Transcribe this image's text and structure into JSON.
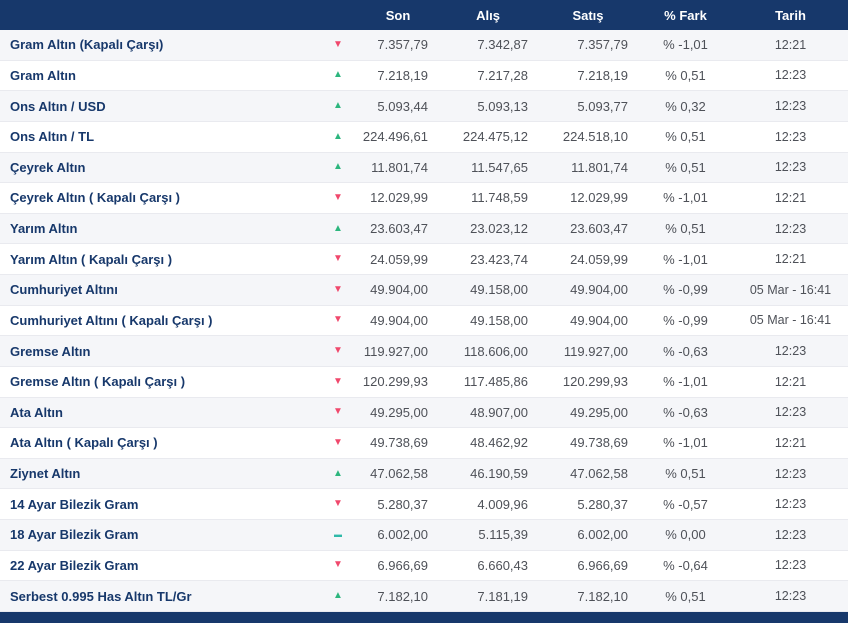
{
  "colors": {
    "header_bg": "#17386b",
    "footer_bg": "#17386b",
    "name_text": "#17386b",
    "value_text": "#4e5158",
    "row_alt_bg": "#f5f6f9",
    "row_border": "#e9eaef",
    "up": "#2db67e",
    "down": "#f0486c",
    "flat": "#2fb9a9"
  },
  "icons": {
    "up": "▲",
    "down": "▼",
    "flat": "▬"
  },
  "header": {
    "name": "",
    "trend": "",
    "son": "Son",
    "alis": "Alış",
    "satis": "Satış",
    "fark": "% Fark",
    "tarih": "Tarih"
  },
  "rows": [
    {
      "name": "Gram Altın (Kapalı Çarşı)",
      "trend": "down",
      "son": "7.357,79",
      "alis": "7.342,87",
      "satis": "7.357,79",
      "fark": "% -1,01",
      "tarih": "12:21"
    },
    {
      "name": "Gram Altın",
      "trend": "up",
      "son": "7.218,19",
      "alis": "7.217,28",
      "satis": "7.218,19",
      "fark": "% 0,51",
      "tarih": "12:23"
    },
    {
      "name": "Ons Altın / USD",
      "trend": "up",
      "son": "5.093,44",
      "alis": "5.093,13",
      "satis": "5.093,77",
      "fark": "% 0,32",
      "tarih": "12:23"
    },
    {
      "name": "Ons Altın / TL",
      "trend": "up",
      "son": "224.496,61",
      "alis": "224.475,12",
      "satis": "224.518,10",
      "fark": "% 0,51",
      "tarih": "12:23"
    },
    {
      "name": "Çeyrek Altın",
      "trend": "up",
      "son": "11.801,74",
      "alis": "11.547,65",
      "satis": "11.801,74",
      "fark": "% 0,51",
      "tarih": "12:23"
    },
    {
      "name": "Çeyrek Altın ( Kapalı Çarşı )",
      "trend": "down",
      "son": "12.029,99",
      "alis": "11.748,59",
      "satis": "12.029,99",
      "fark": "% -1,01",
      "tarih": "12:21"
    },
    {
      "name": "Yarım Altın",
      "trend": "up",
      "son": "23.603,47",
      "alis": "23.023,12",
      "satis": "23.603,47",
      "fark": "% 0,51",
      "tarih": "12:23"
    },
    {
      "name": "Yarım Altın ( Kapalı Çarşı )",
      "trend": "down",
      "son": "24.059,99",
      "alis": "23.423,74",
      "satis": "24.059,99",
      "fark": "% -1,01",
      "tarih": "12:21"
    },
    {
      "name": "Cumhuriyet Altını",
      "trend": "down",
      "son": "49.904,00",
      "alis": "49.158,00",
      "satis": "49.904,00",
      "fark": "% -0,99",
      "tarih": "05 Mar - 16:41"
    },
    {
      "name": "Cumhuriyet Altını ( Kapalı Çarşı )",
      "trend": "down",
      "son": "49.904,00",
      "alis": "49.158,00",
      "satis": "49.904,00",
      "fark": "% -0,99",
      "tarih": "05 Mar - 16:41"
    },
    {
      "name": "Gremse Altın",
      "trend": "down",
      "son": "119.927,00",
      "alis": "118.606,00",
      "satis": "119.927,00",
      "fark": "% -0,63",
      "tarih": "12:23"
    },
    {
      "name": "Gremse Altın ( Kapalı Çarşı )",
      "trend": "down",
      "son": "120.299,93",
      "alis": "117.485,86",
      "satis": "120.299,93",
      "fark": "% -1,01",
      "tarih": "12:21"
    },
    {
      "name": "Ata Altın",
      "trend": "down",
      "son": "49.295,00",
      "alis": "48.907,00",
      "satis": "49.295,00",
      "fark": "% -0,63",
      "tarih": "12:23"
    },
    {
      "name": "Ata Altın ( Kapalı Çarşı )",
      "trend": "down",
      "son": "49.738,69",
      "alis": "48.462,92",
      "satis": "49.738,69",
      "fark": "% -1,01",
      "tarih": "12:21"
    },
    {
      "name": "Ziynet Altın",
      "trend": "up",
      "son": "47.062,58",
      "alis": "46.190,59",
      "satis": "47.062,58",
      "fark": "% 0,51",
      "tarih": "12:23"
    },
    {
      "name": "14 Ayar Bilezik Gram",
      "trend": "down",
      "son": "5.280,37",
      "alis": "4.009,96",
      "satis": "5.280,37",
      "fark": "% -0,57",
      "tarih": "12:23"
    },
    {
      "name": "18 Ayar Bilezik Gram",
      "trend": "flat",
      "son": "6.002,00",
      "alis": "5.115,39",
      "satis": "6.002,00",
      "fark": "% 0,00",
      "tarih": "12:23"
    },
    {
      "name": "22 Ayar Bilezik Gram",
      "trend": "down",
      "son": "6.966,69",
      "alis": "6.660,43",
      "satis": "6.966,69",
      "fark": "% -0,64",
      "tarih": "12:23"
    },
    {
      "name": "Serbest 0.995 Has Altın TL/Gr",
      "trend": "up",
      "son": "7.182,10",
      "alis": "7.181,19",
      "satis": "7.182,10",
      "fark": "% 0,51",
      "tarih": "12:23"
    }
  ]
}
